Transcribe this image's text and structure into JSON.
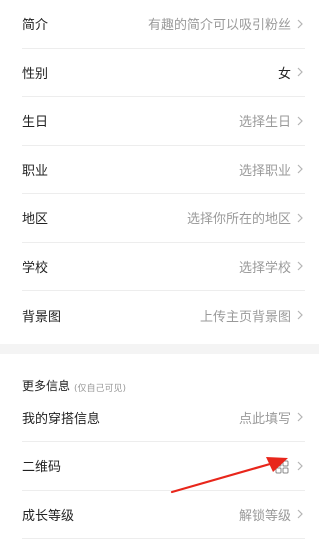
{
  "profile": {
    "rows": [
      {
        "label": "简介",
        "value": "有趣的简介可以吸引粉丝"
      },
      {
        "label": "性别",
        "value": "女"
      },
      {
        "label": "生日",
        "value": "选择生日"
      },
      {
        "label": "职业",
        "value": "选择职业"
      },
      {
        "label": "地区",
        "value": "选择你所在的地区"
      },
      {
        "label": "学校",
        "value": "选择学校"
      },
      {
        "label": "背景图",
        "value": "上传主页背景图"
      }
    ]
  },
  "more": {
    "title": "更多信息",
    "subtitle": "(仅自己可见)",
    "rows": [
      {
        "label": "我的穿搭信息",
        "value": "点此填写"
      },
      {
        "label": "二维码",
        "icon": "qr-code-icon"
      },
      {
        "label": "成长等级",
        "value": "解锁等级"
      }
    ]
  },
  "colors": {
    "annotation_arrow": "#e8261b",
    "divider": "#ededed",
    "value_text": "#9a9a9a"
  }
}
